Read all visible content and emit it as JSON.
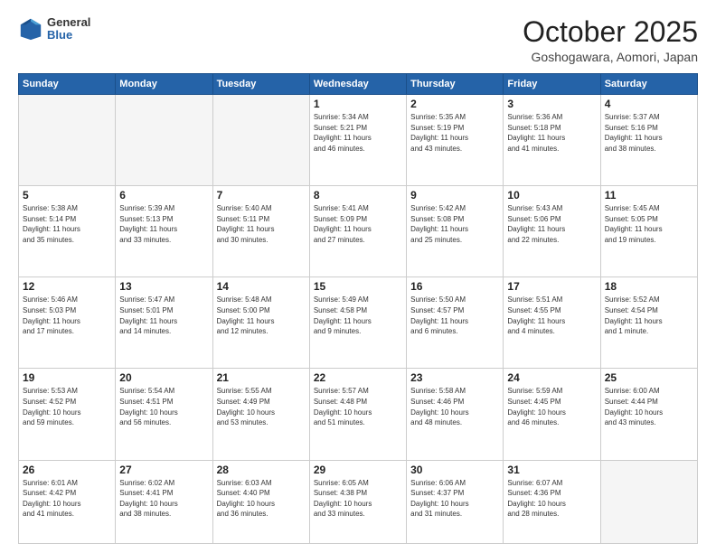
{
  "header": {
    "logo": {
      "general": "General",
      "blue": "Blue"
    },
    "title": "October 2025",
    "location": "Goshogawara, Aomori, Japan"
  },
  "weekdays": [
    "Sunday",
    "Monday",
    "Tuesday",
    "Wednesday",
    "Thursday",
    "Friday",
    "Saturday"
  ],
  "weeks": [
    [
      {
        "day": "",
        "info": ""
      },
      {
        "day": "",
        "info": ""
      },
      {
        "day": "",
        "info": ""
      },
      {
        "day": "1",
        "info": "Sunrise: 5:34 AM\nSunset: 5:21 PM\nDaylight: 11 hours\nand 46 minutes."
      },
      {
        "day": "2",
        "info": "Sunrise: 5:35 AM\nSunset: 5:19 PM\nDaylight: 11 hours\nand 43 minutes."
      },
      {
        "day": "3",
        "info": "Sunrise: 5:36 AM\nSunset: 5:18 PM\nDaylight: 11 hours\nand 41 minutes."
      },
      {
        "day": "4",
        "info": "Sunrise: 5:37 AM\nSunset: 5:16 PM\nDaylight: 11 hours\nand 38 minutes."
      }
    ],
    [
      {
        "day": "5",
        "info": "Sunrise: 5:38 AM\nSunset: 5:14 PM\nDaylight: 11 hours\nand 35 minutes."
      },
      {
        "day": "6",
        "info": "Sunrise: 5:39 AM\nSunset: 5:13 PM\nDaylight: 11 hours\nand 33 minutes."
      },
      {
        "day": "7",
        "info": "Sunrise: 5:40 AM\nSunset: 5:11 PM\nDaylight: 11 hours\nand 30 minutes."
      },
      {
        "day": "8",
        "info": "Sunrise: 5:41 AM\nSunset: 5:09 PM\nDaylight: 11 hours\nand 27 minutes."
      },
      {
        "day": "9",
        "info": "Sunrise: 5:42 AM\nSunset: 5:08 PM\nDaylight: 11 hours\nand 25 minutes."
      },
      {
        "day": "10",
        "info": "Sunrise: 5:43 AM\nSunset: 5:06 PM\nDaylight: 11 hours\nand 22 minutes."
      },
      {
        "day": "11",
        "info": "Sunrise: 5:45 AM\nSunset: 5:05 PM\nDaylight: 11 hours\nand 19 minutes."
      }
    ],
    [
      {
        "day": "12",
        "info": "Sunrise: 5:46 AM\nSunset: 5:03 PM\nDaylight: 11 hours\nand 17 minutes."
      },
      {
        "day": "13",
        "info": "Sunrise: 5:47 AM\nSunset: 5:01 PM\nDaylight: 11 hours\nand 14 minutes."
      },
      {
        "day": "14",
        "info": "Sunrise: 5:48 AM\nSunset: 5:00 PM\nDaylight: 11 hours\nand 12 minutes."
      },
      {
        "day": "15",
        "info": "Sunrise: 5:49 AM\nSunset: 4:58 PM\nDaylight: 11 hours\nand 9 minutes."
      },
      {
        "day": "16",
        "info": "Sunrise: 5:50 AM\nSunset: 4:57 PM\nDaylight: 11 hours\nand 6 minutes."
      },
      {
        "day": "17",
        "info": "Sunrise: 5:51 AM\nSunset: 4:55 PM\nDaylight: 11 hours\nand 4 minutes."
      },
      {
        "day": "18",
        "info": "Sunrise: 5:52 AM\nSunset: 4:54 PM\nDaylight: 11 hours\nand 1 minute."
      }
    ],
    [
      {
        "day": "19",
        "info": "Sunrise: 5:53 AM\nSunset: 4:52 PM\nDaylight: 10 hours\nand 59 minutes."
      },
      {
        "day": "20",
        "info": "Sunrise: 5:54 AM\nSunset: 4:51 PM\nDaylight: 10 hours\nand 56 minutes."
      },
      {
        "day": "21",
        "info": "Sunrise: 5:55 AM\nSunset: 4:49 PM\nDaylight: 10 hours\nand 53 minutes."
      },
      {
        "day": "22",
        "info": "Sunrise: 5:57 AM\nSunset: 4:48 PM\nDaylight: 10 hours\nand 51 minutes."
      },
      {
        "day": "23",
        "info": "Sunrise: 5:58 AM\nSunset: 4:46 PM\nDaylight: 10 hours\nand 48 minutes."
      },
      {
        "day": "24",
        "info": "Sunrise: 5:59 AM\nSunset: 4:45 PM\nDaylight: 10 hours\nand 46 minutes."
      },
      {
        "day": "25",
        "info": "Sunrise: 6:00 AM\nSunset: 4:44 PM\nDaylight: 10 hours\nand 43 minutes."
      }
    ],
    [
      {
        "day": "26",
        "info": "Sunrise: 6:01 AM\nSunset: 4:42 PM\nDaylight: 10 hours\nand 41 minutes."
      },
      {
        "day": "27",
        "info": "Sunrise: 6:02 AM\nSunset: 4:41 PM\nDaylight: 10 hours\nand 38 minutes."
      },
      {
        "day": "28",
        "info": "Sunrise: 6:03 AM\nSunset: 4:40 PM\nDaylight: 10 hours\nand 36 minutes."
      },
      {
        "day": "29",
        "info": "Sunrise: 6:05 AM\nSunset: 4:38 PM\nDaylight: 10 hours\nand 33 minutes."
      },
      {
        "day": "30",
        "info": "Sunrise: 6:06 AM\nSunset: 4:37 PM\nDaylight: 10 hours\nand 31 minutes."
      },
      {
        "day": "31",
        "info": "Sunrise: 6:07 AM\nSunset: 4:36 PM\nDaylight: 10 hours\nand 28 minutes."
      },
      {
        "day": "",
        "info": ""
      }
    ]
  ]
}
